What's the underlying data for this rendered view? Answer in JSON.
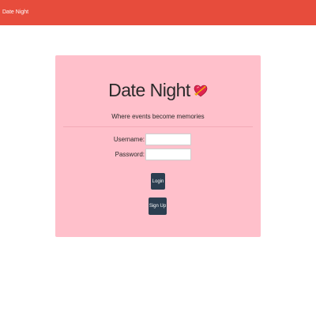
{
  "navbar": {
    "brand": "Date Night",
    "color": "#e74c3c"
  },
  "card": {
    "background": "#ffc0cb",
    "title": "Date Night",
    "title_icon": "heart-with-arrow-icon",
    "tagline": "Where events become memories"
  },
  "form": {
    "username_label": "Username:",
    "username_value": "",
    "password_label": "Password:",
    "password_value": "",
    "login_label": "Login",
    "signup_label": "Sign Up",
    "button_color": "#2c3e50"
  }
}
